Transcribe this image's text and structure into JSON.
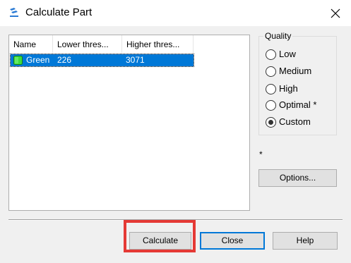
{
  "window": {
    "title": "Calculate Part"
  },
  "list": {
    "columns": [
      "Name",
      "Lower thres...",
      "Higher thres..."
    ],
    "rows": [
      {
        "name": "Green",
        "lower": "226",
        "higher": "3071",
        "color": "#22c55e"
      }
    ]
  },
  "quality": {
    "title": "Quality",
    "options": [
      {
        "label": "Low",
        "checked": false
      },
      {
        "label": "Medium",
        "checked": false
      },
      {
        "label": "High",
        "checked": false
      },
      {
        "label": "Optimal *",
        "checked": false
      },
      {
        "label": "Custom",
        "checked": true
      }
    ]
  },
  "footnote": "*",
  "buttons": {
    "options": "Options...",
    "calculate": "Calculate",
    "close": "Close",
    "help": "Help"
  },
  "colors": {
    "selection": "#0078d7",
    "highlight": "#e53935"
  }
}
